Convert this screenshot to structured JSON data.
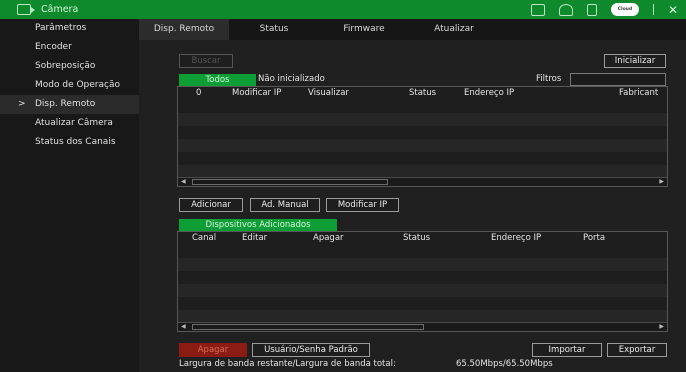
{
  "titlebar": {
    "title": "Câmera",
    "cloud_label": "Cloud"
  },
  "sidebar": {
    "items": [
      {
        "label": "Parâmetros"
      },
      {
        "label": "Encoder"
      },
      {
        "label": "Sobreposição"
      },
      {
        "label": "Modo de Operação"
      },
      {
        "label": "Disp. Remoto",
        "active": true
      },
      {
        "label": "Atualizar Câmera"
      },
      {
        "label": "Status dos Canais"
      }
    ]
  },
  "tabs": [
    {
      "label": "Disp. Remoto",
      "active": true
    },
    {
      "label": "Status"
    },
    {
      "label": "Firmware"
    },
    {
      "label": "Atualizar"
    }
  ],
  "toolbar": {
    "buscar": "Buscar",
    "inicializar": "Inicializar"
  },
  "filter": {
    "todos": "Todos",
    "nao_inicializado": "Não inicializado",
    "filtros_label": "Filtros",
    "filtros_value": ""
  },
  "search_table": {
    "columns": [
      "0",
      "Modificar IP",
      "Visualizar",
      "Status",
      "Endereço IP",
      "Fabricant"
    ]
  },
  "actions": {
    "adicionar": "Adicionar",
    "ad_manual": "Ad. Manual",
    "modificar_ip": "Modificar IP"
  },
  "added": {
    "tab_label": "Dispositivos Adicionados",
    "columns": [
      "Canal",
      "Editar",
      "Apagar",
      "Status",
      "Endereço IP",
      "Porta"
    ]
  },
  "bottom": {
    "apagar": "Apagar",
    "usuario_senha": "Usuário/Senha Padrão",
    "importar": "Importar",
    "exportar": "Exportar",
    "bandwidth_label": "Largura de banda restante/Largura de banda total:",
    "bandwidth_value": "65.50Mbps/65.50Mbps"
  },
  "colors": {
    "accent": "#0e8a2c",
    "tab_green": "#0e9e35",
    "delete_red": "#8b1c14"
  }
}
